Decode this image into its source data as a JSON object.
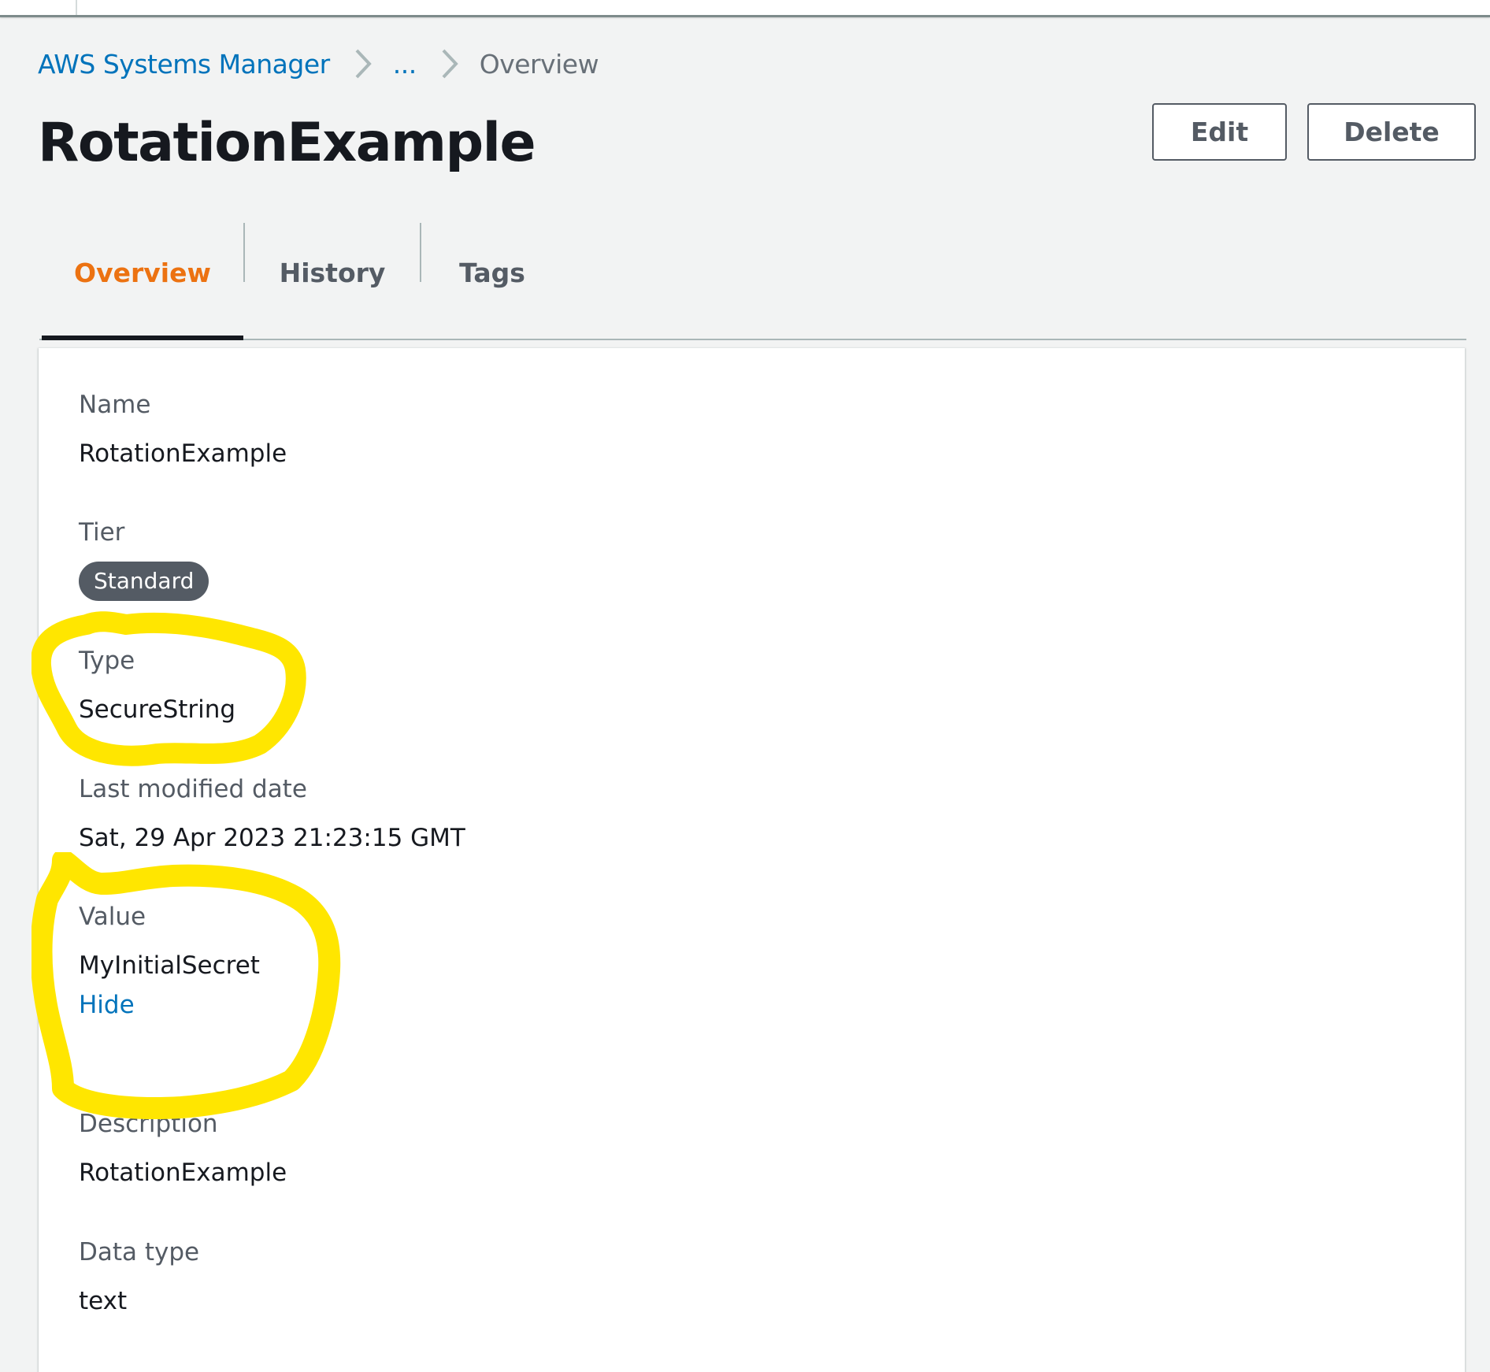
{
  "breadcrumb": {
    "items": [
      {
        "label": "AWS Systems Manager",
        "link": true
      },
      {
        "label": "...",
        "link": true
      },
      {
        "label": "Overview",
        "link": false
      }
    ]
  },
  "header": {
    "title": "RotationExample",
    "edit_label": "Edit",
    "delete_label": "Delete"
  },
  "tabs": [
    {
      "label": "Overview",
      "active": true
    },
    {
      "label": "History",
      "active": false
    },
    {
      "label": "Tags",
      "active": false
    }
  ],
  "details": {
    "name": {
      "label": "Name",
      "value": "RotationExample"
    },
    "tier": {
      "label": "Tier",
      "value": "Standard"
    },
    "type": {
      "label": "Type",
      "value": "SecureString"
    },
    "last_modified": {
      "label": "Last modified date",
      "value": "Sat, 29 Apr 2023 21:23:15 GMT"
    },
    "value": {
      "label": "Value",
      "value": "MyInitialSecret",
      "toggle_label": "Hide"
    },
    "description": {
      "label": "Description",
      "value": "RotationExample"
    },
    "data_type": {
      "label": "Data type",
      "value": "text"
    }
  },
  "annotations": [
    {
      "shape": "freehand-circle",
      "color": "#ffe600",
      "target": "type"
    },
    {
      "shape": "freehand-circle",
      "color": "#ffe600",
      "target": "value"
    }
  ],
  "colors": {
    "link": "#0073bb",
    "active_tab": "#ec7211",
    "badge": "#545b64",
    "highlight": "#ffe600"
  }
}
